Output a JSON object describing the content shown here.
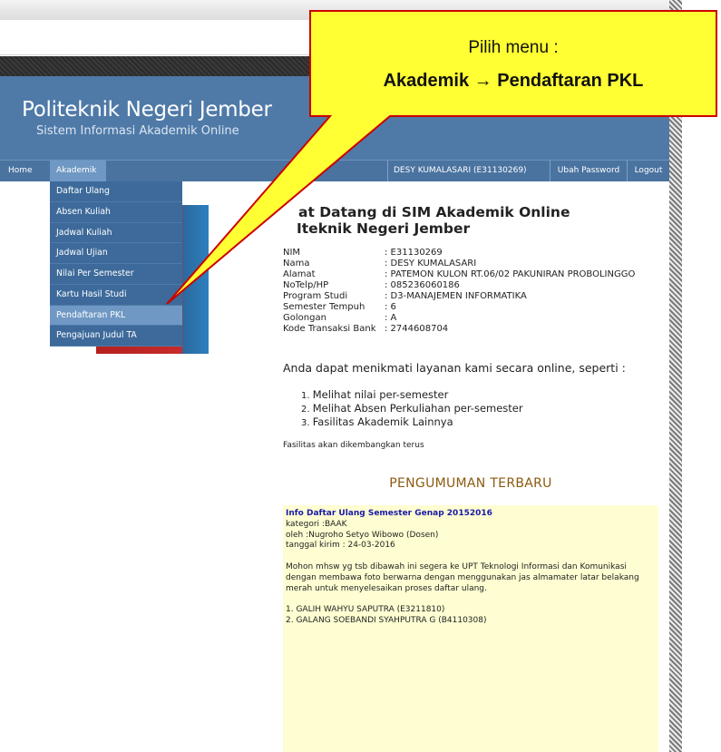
{
  "site": {
    "title": "Politeknik Negeri Jember",
    "subtitle": "Sistem Informasi Akademik Online"
  },
  "nav": {
    "home": "Home",
    "akademik": "Akademik",
    "user": "DESY KUMALASARI (E31130269)",
    "change_password": "Ubah Password",
    "logout": "Logout"
  },
  "dropdown": {
    "items": [
      "Daftar Ulang",
      "Absen Kuliah",
      "Jadwal Kuliah",
      "Jadwal Ujian",
      "Nilai Per Semester",
      "Kartu Hasil Studi",
      "Pendaftaran PKL",
      "Pengajuan Judul TA"
    ],
    "active": "Pendaftaran PKL"
  },
  "welcome": {
    "line1": "at Datang di SIM Akademik Online",
    "line2": "Iteknik Negeri Jember"
  },
  "profile": [
    {
      "label": "NIM",
      "value": ": E31130269"
    },
    {
      "label": "Nama",
      "value": ": DESY KUMALASARI"
    },
    {
      "label": "Alamat",
      "value": ": PATEMON KULON RT.06/02 PAKUNIRAN PROBOLINGGO"
    },
    {
      "label": "NoTelp/HP",
      "value": ": 085236060186"
    },
    {
      "label": "Program Studi",
      "value": ": D3-MANAJEMEN INFORMATIKA"
    },
    {
      "label": "Semester Tempuh",
      "value": ": 6"
    },
    {
      "label": "Golongan",
      "value": ": A"
    },
    {
      "label": "Kode Transaksi Bank",
      "value": ": 2744608704"
    }
  ],
  "intro": "Anda dapat menikmati layanan kami secara online, seperti :",
  "features": [
    "Melihat nilai per-semester",
    "Melihat Absen Perkuliahan per-semester",
    "Fasilitas Akademik Lainnya"
  ],
  "note": "Fasilitas akan dikembangkan terus",
  "announcement": {
    "heading": "PENGUMUMAN TERBARU",
    "title": "Info Daftar Ulang Semester Genap 20152016",
    "category": "kategori :BAAK",
    "author": "oleh :Nugroho Setyo Wibowo (Dosen)",
    "date": "tanggal kirim : 24-03-2016",
    "body1": "Mohon mhsw yg tsb dibawah ini segera ke UPT Teknologi Informasi dan Komunikasi",
    "body2": "dengan membawa foto berwarna dengan menggunakan jas almamater latar belakang",
    "body3": "merah untuk menyelesaikan proses daftar ulang.",
    "list1": "1. GALIH WAHYU SAPUTRA (E3211810)",
    "list2": "2. GALANG SOEBANDI SYAHPUTRA G (B4110308)"
  },
  "callout": {
    "line1": "Pilih menu :",
    "line2_a": "Akademik",
    "arrow": "→",
    "line2_b": "Pendaftaran PKL"
  },
  "colors": {
    "header_bg": "#4f7aa8",
    "dropdown_bg": "#3d6a9a",
    "active_item": "#6f98c4",
    "callout_fill": "#ffff33",
    "callout_border": "#cc0000",
    "announce_bg": "#fefed2",
    "announce_heading": "#8b5a10"
  }
}
